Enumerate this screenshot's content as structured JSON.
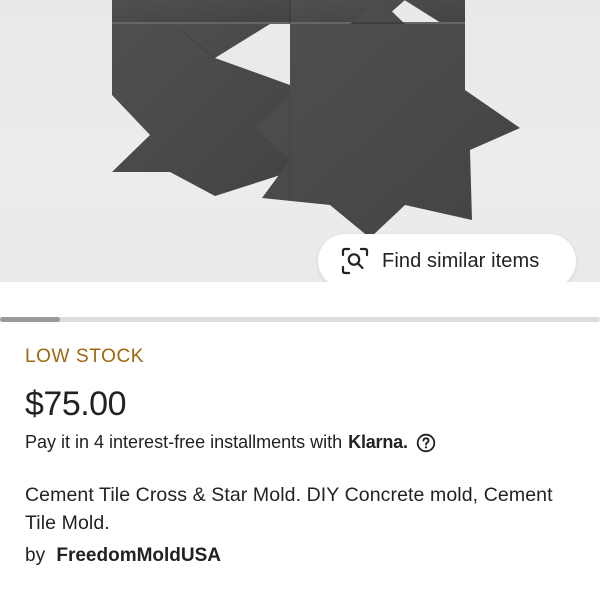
{
  "hero": {
    "find_similar_label": "Find similar items",
    "find_similar_icon": "visual-search-icon"
  },
  "gallery": {
    "scroll_position": 0.1
  },
  "product": {
    "stock_status": "LOW STOCK",
    "price": "$75.00",
    "installments_text": "Pay it in 4 interest-free installments with",
    "installments_brand": "Klarna.",
    "title": "Cement Tile Cross & Star Mold. DIY Concrete mold, Cement Tile Mold.",
    "shop_prefix": "by",
    "shop_name": "FreedomMoldUSA"
  },
  "colors": {
    "stock_status": "#a0660f",
    "tile": "#4a494b",
    "background": "#eaeaeb"
  }
}
